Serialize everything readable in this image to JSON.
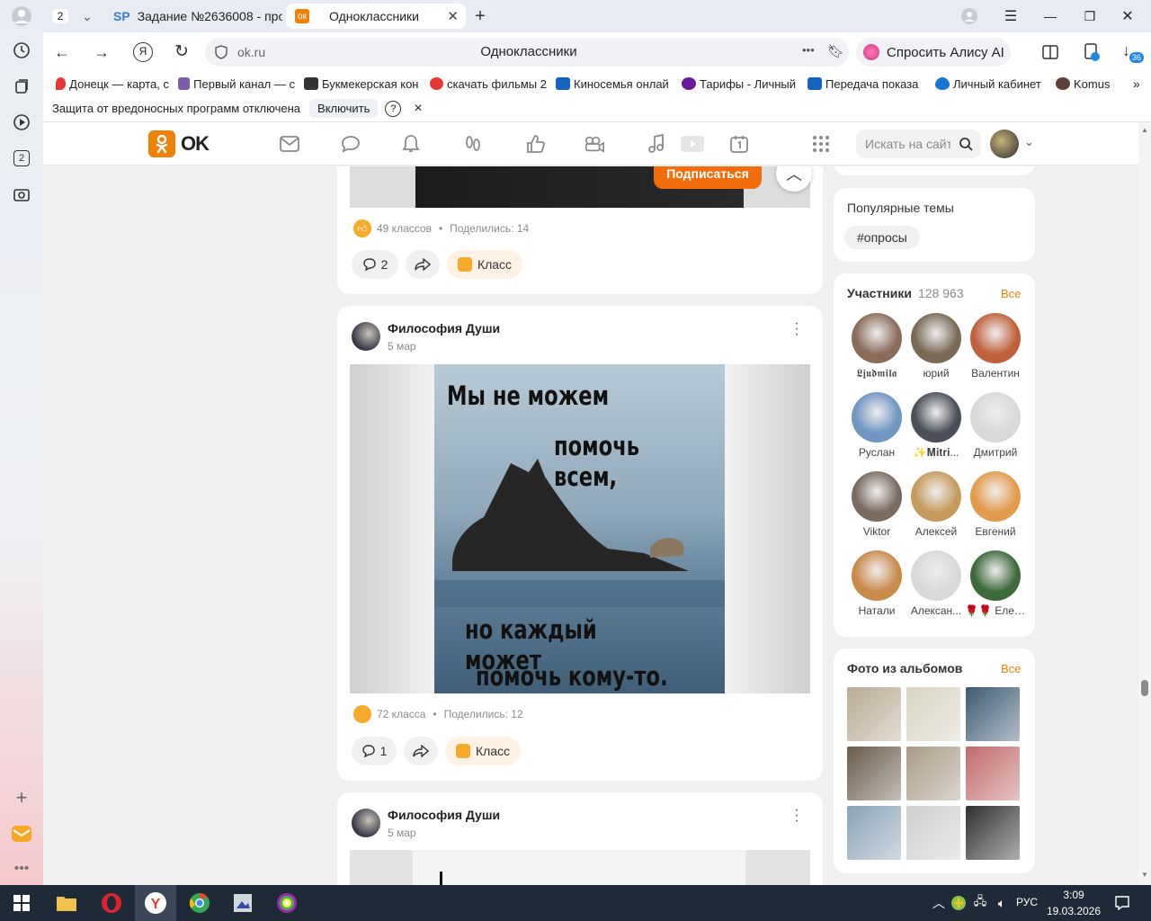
{
  "browser": {
    "tab_count": "2",
    "tabs": [
      {
        "label": "Задание №2636008 - про"
      },
      {
        "label": "Одноклассники"
      }
    ],
    "address": "ok.ru",
    "page_title": "Одноклассники",
    "alice_button": "Спросить Алису AI",
    "downloads_badge": "36",
    "sidebar_badge": "2"
  },
  "bookmarks": [
    {
      "label": "Донецк — карта, с",
      "color": "#e53935"
    },
    {
      "label": "Первый канал — с",
      "color": "#7b5ea7"
    },
    {
      "label": "Букмекерская кон",
      "color": "#333333"
    },
    {
      "label": "скачать фильмы 2",
      "color": "#e53935"
    },
    {
      "label": "Киносемья онлай",
      "color": "#1565c0"
    },
    {
      "label": "Тарифы - Личный",
      "color": "#6a1b9a"
    },
    {
      "label": "Передача показа",
      "color": "#1565c0"
    },
    {
      "label": "Личный кабинет",
      "color": "#1976d2"
    },
    {
      "label": "Komus",
      "color": "#5d4037"
    }
  ],
  "protection": {
    "text": "Защита от вредоносных программ отключена",
    "button": "Включить",
    "help": "?",
    "close": "×"
  },
  "ok_header": {
    "logo": "OK",
    "search_placeholder": "Искать на сайте"
  },
  "post_top": {
    "subscribe": "Подписаться",
    "likes": "49 классов",
    "shares": "Поделились: 14",
    "comments": "2",
    "klass": "Класс"
  },
  "post_main": {
    "author": "Философия Души",
    "date": "5 мар",
    "image_text": [
      "Мы не можем",
      "помочь всем,",
      "но каждый может",
      "помочь кому-то."
    ],
    "likes": "72 класса",
    "shares": "Поделились: 12",
    "comments": "1",
    "klass": "Класс"
  },
  "post_next": {
    "author": "Философия Души",
    "date": "5 мар"
  },
  "popular": {
    "title": "Популярные темы",
    "tag": "#опросы"
  },
  "members": {
    "title": "Участники",
    "count": "128 963",
    "all": "Все",
    "items": [
      {
        "name": "𝕷𝖏𝖚𝖉𝖒𝖎𝖑𝖆",
        "color": "#8a6b5a"
      },
      {
        "name": "юрий",
        "color": "#7a6a55"
      },
      {
        "name": "Валентин",
        "color": "#c0603a"
      },
      {
        "name": "Руслан",
        "color": "#6f95c2"
      },
      {
        "name": "✨𝐌𝐢𝐭𝐫𝐢...",
        "color": "#4a4f58"
      },
      {
        "name": "Дмитрий",
        "color": "#d9d9d9"
      },
      {
        "name": "Viktor",
        "color": "#7a6b60"
      },
      {
        "name": "Алексей",
        "color": "#c59a5b"
      },
      {
        "name": "Евгений",
        "color": "#e39a4a"
      },
      {
        "name": "Натали",
        "color": "#c98a4a"
      },
      {
        "name": "Алексан...",
        "color": "#d9d9d9"
      },
      {
        "name": "🌹🌹 Елена",
        "color": "#3d6a3a"
      }
    ]
  },
  "album": {
    "title": "Фото из альбомов",
    "all": "Все",
    "photos": [
      "#b9ab94",
      "#d9d5c3",
      "#3b5a72",
      "#6a5b4a",
      "#a99a86",
      "#c26a6a",
      "#8aa3b5",
      "#cfcfcf",
      "#2f2f2f"
    ]
  },
  "taskbar": {
    "lang": "РУС",
    "time": "3:09",
    "date": "19.03.2026"
  }
}
